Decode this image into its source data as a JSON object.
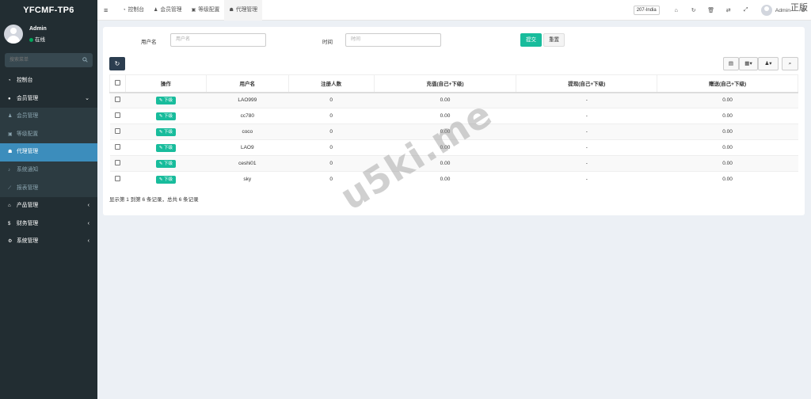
{
  "app": {
    "logo": "YFCMF-TP6"
  },
  "user": {
    "name": "Admin",
    "status": "在线"
  },
  "sidebar": {
    "search_placeholder": "搜索菜单",
    "items": [
      {
        "label": "控制台",
        "icon": "dashboard-icon",
        "type": "top"
      },
      {
        "label": "会员管理",
        "icon": "user-circle-icon",
        "type": "top",
        "arrow": "⌄"
      },
      {
        "label": "会员管理",
        "icon": "user-icon",
        "type": "sub"
      },
      {
        "label": "等级配置",
        "icon": "list-icon",
        "type": "sub"
      },
      {
        "label": "代理管理",
        "icon": "sitemap-icon",
        "type": "active"
      },
      {
        "label": "系统通知",
        "icon": "bell-icon",
        "type": "sub"
      },
      {
        "label": "报表管理",
        "icon": "chart-icon",
        "type": "sub"
      },
      {
        "label": "产品管理",
        "icon": "home-icon",
        "type": "top",
        "arrow": "‹"
      },
      {
        "label": "财务管理",
        "icon": "money-icon",
        "type": "top",
        "arrow": "‹"
      },
      {
        "label": "系统管理",
        "icon": "cogs-icon",
        "type": "top",
        "arrow": "‹"
      }
    ]
  },
  "topbar": {
    "tabs": [
      {
        "label": "控制台",
        "icon": "dashboard-icon"
      },
      {
        "label": "会员管理",
        "icon": "user-icon"
      },
      {
        "label": "等级配置",
        "icon": "list-icon"
      },
      {
        "label": "代理管理",
        "icon": "sitemap-icon",
        "active": true
      }
    ],
    "db_select": "207-India",
    "admin_label": "Admin",
    "corner_text": "正版"
  },
  "filter": {
    "username_label": "用户名",
    "username_placeholder": "用户名",
    "time_label": "时间",
    "time_placeholder": "时间",
    "submit_label": "提交",
    "reset_label": "重置"
  },
  "table": {
    "columns": [
      "操作",
      "用户名",
      "注册人数",
      "充值(自己+下级)",
      "提现(自己+下级)",
      "赠送(自己+下级)"
    ],
    "action_label": "下级",
    "rows": [
      {
        "username": "LAO999",
        "registered": "0",
        "recharge": "0.00",
        "withdraw": "-",
        "gift": "0.00"
      },
      {
        "username": "cc780",
        "registered": "0",
        "recharge": "0.00",
        "withdraw": "-",
        "gift": "0.00"
      },
      {
        "username": "coco",
        "registered": "0",
        "recharge": "0.00",
        "withdraw": "-",
        "gift": "0.00"
      },
      {
        "username": "LAO9",
        "registered": "0",
        "recharge": "0.00",
        "withdraw": "-",
        "gift": "0.00"
      },
      {
        "username": "ceshi01",
        "registered": "0",
        "recharge": "0.00",
        "withdraw": "-",
        "gift": "0.00"
      },
      {
        "username": "sky",
        "registered": "0",
        "recharge": "0.00",
        "withdraw": "-",
        "gift": "0.00"
      }
    ],
    "summary": "显示第 1 到第 6 条记录，总共 6 条记录"
  },
  "watermark": "u5ki.me",
  "colors": {
    "sidebar_bg": "#222d32",
    "active_menu": "#3c8dbc",
    "primary_green": "#18bc9c",
    "refresh_btn": "#2c3e50"
  }
}
